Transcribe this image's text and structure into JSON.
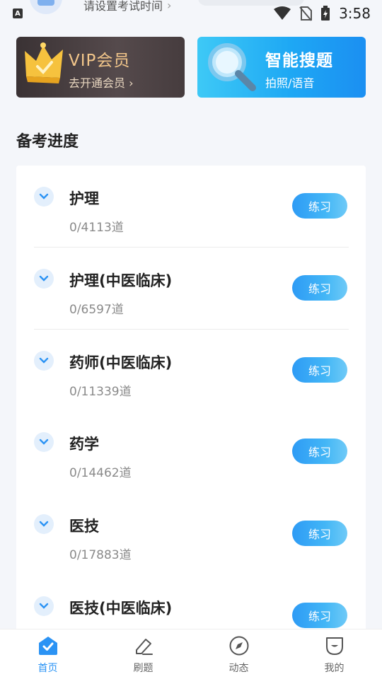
{
  "status_bar": {
    "time": "3:58",
    "exam_time_prompt": "请设置考试时间",
    "chevron": "›",
    "sys_badge": "A"
  },
  "promos": {
    "vip": {
      "title": "VIP会员",
      "subtitle": "去开通会员 ›",
      "icon": "crown-icon"
    },
    "search": {
      "title": "智能搜题",
      "subtitle": "拍照/语音",
      "icon": "magnifier-icon"
    }
  },
  "section": {
    "title": "备考进度"
  },
  "subjects": [
    {
      "name": "护理",
      "count": "0/4113道",
      "action": "练习"
    },
    {
      "name": "护理(中医临床)",
      "count": "0/6597道",
      "action": "练习"
    },
    {
      "name": "药师(中医临床)",
      "count": "0/11339道",
      "action": "练习"
    },
    {
      "name": "药学",
      "count": "0/14462道",
      "action": "练习"
    },
    {
      "name": "医技",
      "count": "0/17883道",
      "action": "练习"
    },
    {
      "name": "医技(中医临床)",
      "count": "",
      "action": "练习"
    }
  ],
  "bottom_nav": [
    {
      "label": "首页",
      "icon": "home-icon",
      "active": true
    },
    {
      "label": "刷题",
      "icon": "pencil-icon",
      "active": false
    },
    {
      "label": "动态",
      "icon": "compass-icon",
      "active": false
    },
    {
      "label": "我的",
      "icon": "profile-icon",
      "active": false
    }
  ],
  "colors": {
    "accent": "#2b93f4",
    "vip_gold": "#f1c58a",
    "background": "#f4f6fa"
  }
}
